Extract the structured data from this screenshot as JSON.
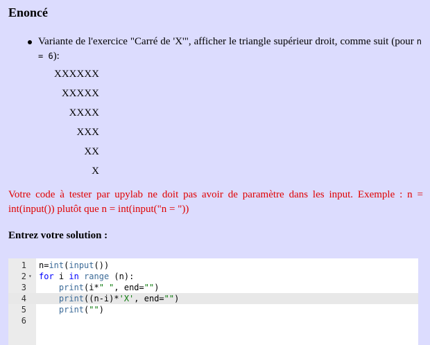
{
  "title": "Enoncé",
  "bullet": {
    "text_before": "Variante de l'exercice \"Carré de 'X'\", afficher le triangle supérieur droit, comme suit (pour ",
    "inline_code": "n = 6",
    "text_after": "):"
  },
  "triangle": [
    "XXXXXX",
    "XXXXX",
    "XXXX",
    "XXX",
    "XX",
    "X"
  ],
  "warning": "Votre code à tester par upylab ne doit pas avoir de paramètre dans les input. Exemple : n = int(input()) plutôt que n = int(input(\"n = \"))",
  "prompt": "Entrez votre solution :",
  "editor": {
    "active_line": 4,
    "lines": [
      {
        "num": "1",
        "fold": "",
        "code": "n=int(input())"
      },
      {
        "num": "2",
        "fold": "▾",
        "code": "for i in range (n):"
      },
      {
        "num": "3",
        "fold": "",
        "code": "    print(i*\" \", end=\"\")"
      },
      {
        "num": "4",
        "fold": "",
        "code": "    print((n-i)*'X', end=\"\")"
      },
      {
        "num": "5",
        "fold": "",
        "code": "    print(\"\")"
      },
      {
        "num": "6",
        "fold": "",
        "code": ""
      }
    ]
  }
}
